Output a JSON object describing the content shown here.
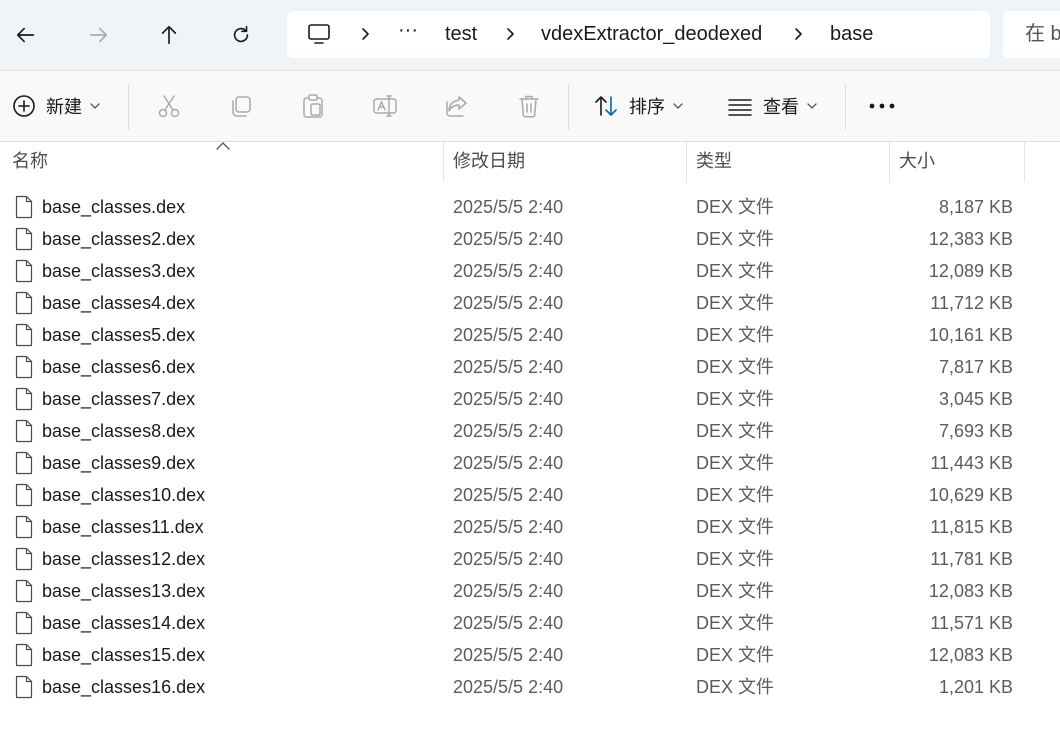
{
  "navigation": {
    "back_icon": "arrow-left-icon",
    "forward_icon": "arrow-right-icon",
    "up_icon": "arrow-up-icon",
    "refresh_icon": "refresh-icon"
  },
  "address_bar": {
    "computer_icon": "monitor-icon",
    "more_label": "···",
    "crumbs": [
      "test",
      "vdexExtractor_deodexed",
      "base"
    ]
  },
  "search": {
    "placeholder": "在 b"
  },
  "command_bar": {
    "new_label": "新建",
    "sort_label": "排序",
    "view_label": "查看",
    "more_label": "···"
  },
  "columns": {
    "name": "名称",
    "date": "修改日期",
    "type": "类型",
    "size": "大小"
  },
  "files": [
    {
      "name": "base_classes.dex",
      "date": "2025/5/5 2:40",
      "type": "DEX 文件",
      "size": "8,187 KB"
    },
    {
      "name": "base_classes2.dex",
      "date": "2025/5/5 2:40",
      "type": "DEX 文件",
      "size": "12,383 KB"
    },
    {
      "name": "base_classes3.dex",
      "date": "2025/5/5 2:40",
      "type": "DEX 文件",
      "size": "12,089 KB"
    },
    {
      "name": "base_classes4.dex",
      "date": "2025/5/5 2:40",
      "type": "DEX 文件",
      "size": "11,712 KB"
    },
    {
      "name": "base_classes5.dex",
      "date": "2025/5/5 2:40",
      "type": "DEX 文件",
      "size": "10,161 KB"
    },
    {
      "name": "base_classes6.dex",
      "date": "2025/5/5 2:40",
      "type": "DEX 文件",
      "size": "7,817 KB"
    },
    {
      "name": "base_classes7.dex",
      "date": "2025/5/5 2:40",
      "type": "DEX 文件",
      "size": "3,045 KB"
    },
    {
      "name": "base_classes8.dex",
      "date": "2025/5/5 2:40",
      "type": "DEX 文件",
      "size": "7,693 KB"
    },
    {
      "name": "base_classes9.dex",
      "date": "2025/5/5 2:40",
      "type": "DEX 文件",
      "size": "11,443 KB"
    },
    {
      "name": "base_classes10.dex",
      "date": "2025/5/5 2:40",
      "type": "DEX 文件",
      "size": "10,629 KB"
    },
    {
      "name": "base_classes11.dex",
      "date": "2025/5/5 2:40",
      "type": "DEX 文件",
      "size": "11,815 KB"
    },
    {
      "name": "base_classes12.dex",
      "date": "2025/5/5 2:40",
      "type": "DEX 文件",
      "size": "11,781 KB"
    },
    {
      "name": "base_classes13.dex",
      "date": "2025/5/5 2:40",
      "type": "DEX 文件",
      "size": "12,083 KB"
    },
    {
      "name": "base_classes14.dex",
      "date": "2025/5/5 2:40",
      "type": "DEX 文件",
      "size": "11,571 KB"
    },
    {
      "name": "base_classes15.dex",
      "date": "2025/5/5 2:40",
      "type": "DEX 文件",
      "size": "12,083 KB"
    },
    {
      "name": "base_classes16.dex",
      "date": "2025/5/5 2:40",
      "type": "DEX 文件",
      "size": "1,201 KB"
    }
  ],
  "colors": {
    "accent": "#0067c0",
    "nav_bg": "#eff4f9",
    "disabled": "#a9a9a9"
  }
}
